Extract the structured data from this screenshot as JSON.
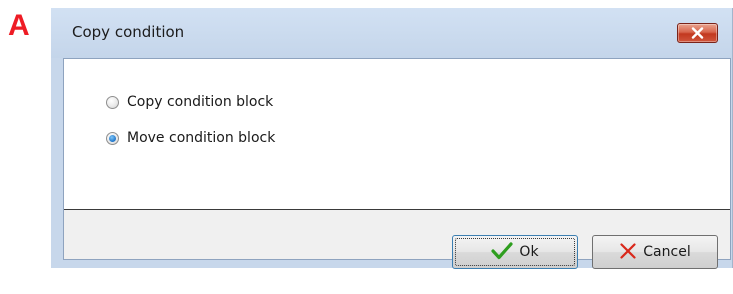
{
  "panel_label": "A",
  "dialog": {
    "title": "Copy condition",
    "options": [
      {
        "label": "Copy condition block",
        "selected": false
      },
      {
        "label": "Move condition block",
        "selected": true
      }
    ],
    "buttons": {
      "ok_label": "Ok",
      "cancel_label": "Cancel"
    }
  },
  "icons": {
    "close": "close-icon",
    "ok": "checkmark-icon",
    "cancel": "x-icon"
  },
  "colors": {
    "panel_label": "#ee1c25",
    "ok_check": "#2e9e1f",
    "cancel_x": "#d9281b",
    "close_button": "#c7432b"
  }
}
